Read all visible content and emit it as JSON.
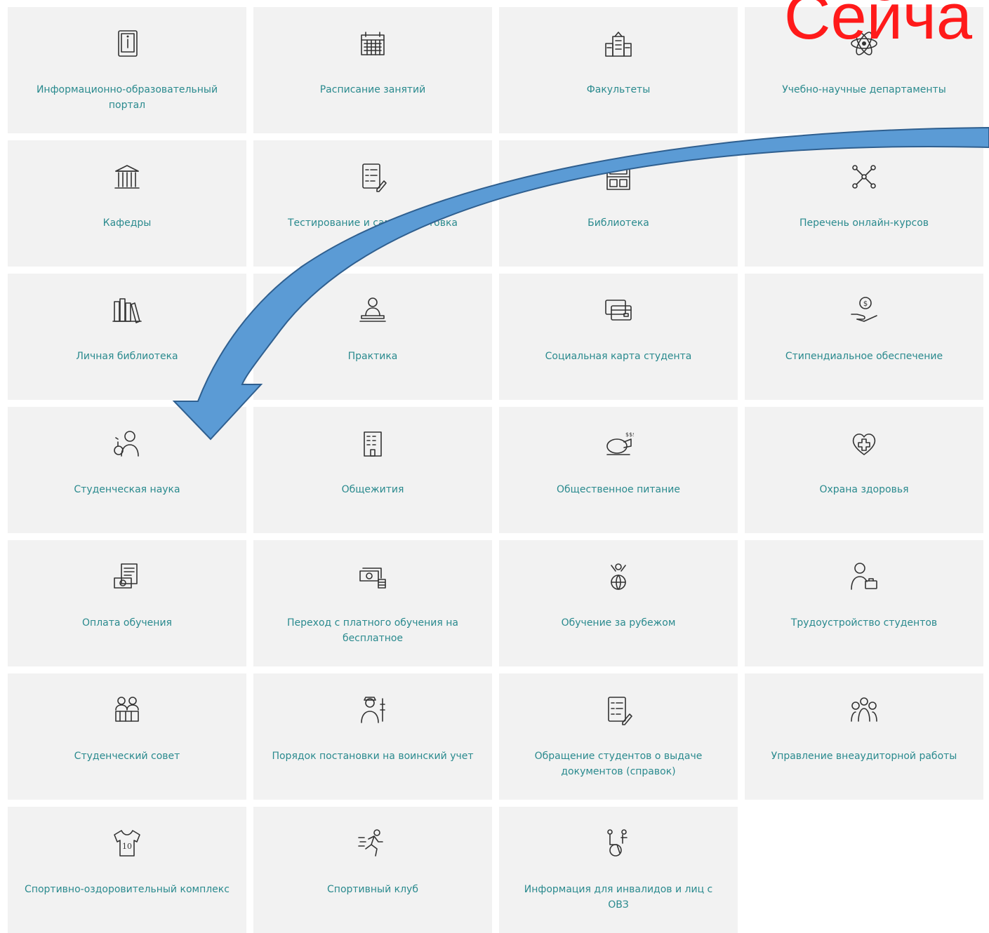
{
  "overlay_title": "Сейча",
  "colors": {
    "tile_bg": "#f2f2f2",
    "label": "#2a8a8e",
    "headline": "#ff1a1a",
    "arrow": "#5b9bd5"
  },
  "tiles": [
    {
      "label": "Информационно-образовательный портал",
      "icon": "info-book-icon"
    },
    {
      "label": "Расписание занятий",
      "icon": "calendar-icon"
    },
    {
      "label": "Факультеты",
      "icon": "building-icon"
    },
    {
      "label": "Учебно-научные департаменты",
      "icon": "atom-icon"
    },
    {
      "label": "Кафедры",
      "icon": "columns-building-icon"
    },
    {
      "label": "Тестирование и самоподготовка",
      "icon": "checklist-icon"
    },
    {
      "label": "Библиотека",
      "icon": "library-icon"
    },
    {
      "label": "Перечень онлайн-курсов",
      "icon": "network-icon"
    },
    {
      "label": "Личная библиотека",
      "icon": "books-icon"
    },
    {
      "label": "Практика",
      "icon": "worker-desk-icon"
    },
    {
      "label": "Социальная карта студента",
      "icon": "cards-icon"
    },
    {
      "label": "Стипендиальное обеспечение",
      "icon": "coin-hand-icon"
    },
    {
      "label": "Студенческая наука",
      "icon": "scientist-icon"
    },
    {
      "label": "Общежития",
      "icon": "dormitory-icon"
    },
    {
      "label": "Общественное питание",
      "icon": "food-icon"
    },
    {
      "label": "Охрана здоровья",
      "icon": "health-heart-icon"
    },
    {
      "label": "Оплата обучения",
      "icon": "payment-doc-icon"
    },
    {
      "label": "Переход с платного обучения на бесплатное",
      "icon": "money-stack-icon"
    },
    {
      "label": "Обучение за рубежом",
      "icon": "globe-person-icon"
    },
    {
      "label": "Трудоустройство студентов",
      "icon": "employee-icon"
    },
    {
      "label": "Студенческий совет",
      "icon": "council-icon"
    },
    {
      "label": "Порядок постановки на воинский учет",
      "icon": "soldier-icon"
    },
    {
      "label": "Обращение студентов о выдаче документов (справок)",
      "icon": "checklist-icon"
    },
    {
      "label": "Управление  внеаудиторной работы",
      "icon": "group-icon"
    },
    {
      "label": "Спортивно-оздоровительный комплекс",
      "icon": "jersey-icon"
    },
    {
      "label": "Спортивный клуб",
      "icon": "runner-icon"
    },
    {
      "label": "Информация для инвалидов и лиц с ОВЗ",
      "icon": "wheelchair-icon"
    }
  ]
}
